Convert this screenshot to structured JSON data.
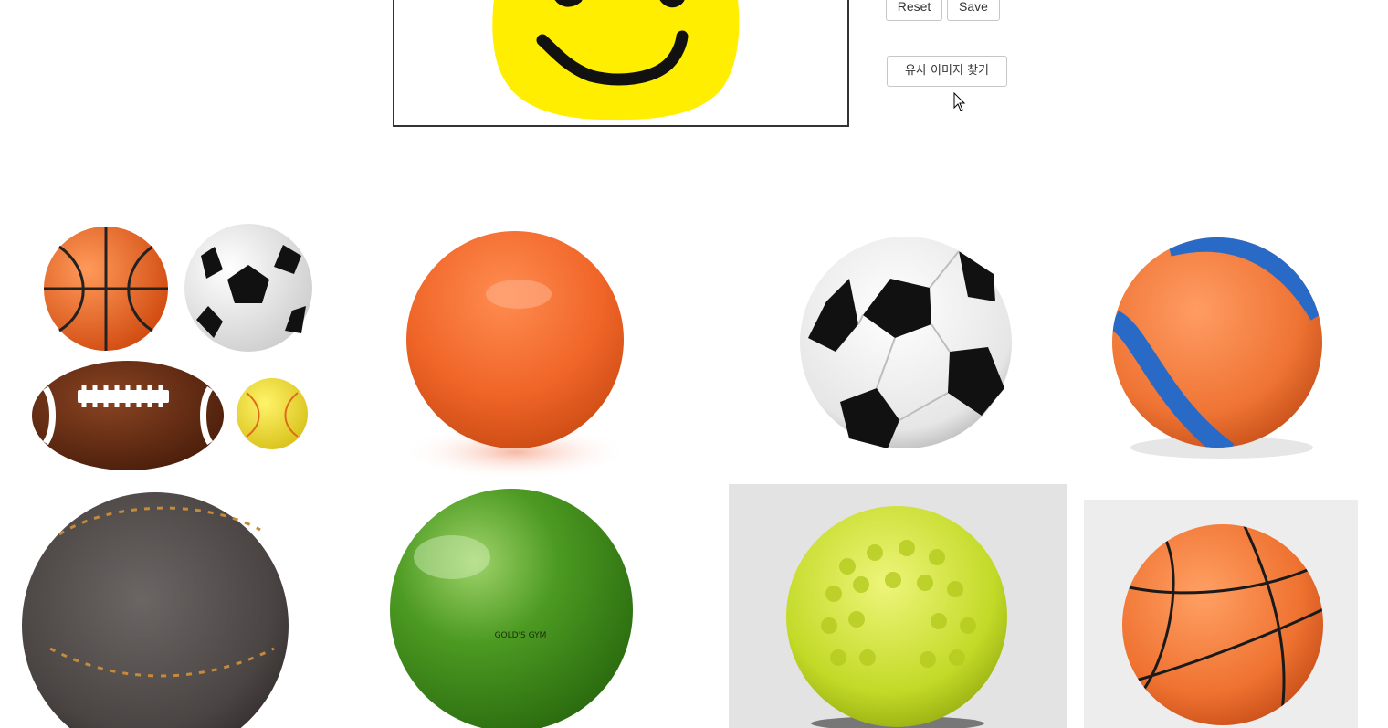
{
  "toolbar": {
    "reset_label": "Reset",
    "save_label": "Save",
    "find_similar_label": "유사 이미지 찾기"
  },
  "drawing": {
    "face_color": "#ffee00",
    "stroke_color": "#111111"
  },
  "results": [
    {
      "name": "ball-collage",
      "icon": "sports-balls-collage"
    },
    {
      "name": "orange-exercise-ball",
      "color": "#f26a2e",
      "icon": "exercise-ball"
    },
    {
      "name": "soccer-ball",
      "icon": "soccer-ball"
    },
    {
      "name": "orange-blue-stripe-ball",
      "color": "#f07a3a",
      "icon": "rubber-ball"
    },
    {
      "name": "leather-stitched-ball",
      "color": "#4d4746",
      "icon": "leather-ball"
    },
    {
      "name": "green-exercise-ball",
      "color": "#3e8a1a",
      "icon": "exercise-ball"
    },
    {
      "name": "yellow-dimpled-ball",
      "color": "#c6dc2a",
      "icon": "dimpled-ball"
    },
    {
      "name": "orange-basketball",
      "color": "#f0742f",
      "icon": "basketball"
    }
  ]
}
